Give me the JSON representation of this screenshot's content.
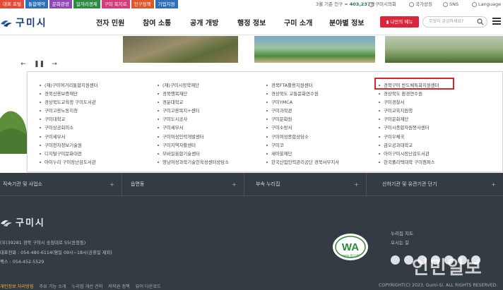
{
  "topbar": {
    "quick_links": [
      {
        "label": "대표 포털",
        "color": "#e44c3a"
      },
      {
        "label": "통합예약",
        "color": "#2f6fb9"
      },
      {
        "label": "문화관광",
        "color": "#8f4ab7"
      },
      {
        "label": "일자리경제",
        "color": "#2d8b43"
      },
      {
        "label": "구미 복지로",
        "color": "#d83b7c"
      },
      {
        "label": "인구정책",
        "color": "#e0572a"
      },
      {
        "label": "기업지원",
        "color": "#2f6fb9"
      }
    ],
    "population_prefix": "3월 기준 인구 ≈",
    "population_value": "403,237",
    "population_unit": "명",
    "council": "구미시의회",
    "sitemap": "국가상징",
    "sns": "SNS",
    "language": "Language"
  },
  "header": {
    "logo_text": "구미시",
    "nav": [
      "전자 민원",
      "참여 소통",
      "공개 개방",
      "행정 정보",
      "구미 소개",
      "분야별 정보"
    ],
    "my_menu_label": "나만의 메뉴",
    "search_placeholder": "무엇이 궁금하세요?"
  },
  "slider": {
    "prev": "←",
    "pause": "❚❚",
    "next": "→"
  },
  "dropdown": {
    "columns": [
      [
        "(재)구미여거리통합지원센터",
        "경북신용보증재단",
        "경상북도교육청 구미도서관",
        "구미고용노동지청",
        "구미대학교",
        "구미상공회의소",
        "구미세무서",
        "구미전자정보기술원",
        "디지털구미문화대전",
        "아이누리 구미장난감도서관"
      ],
      [
        "(재)구미시장학재단",
        "경북행복재단",
        "경운대학교",
        "구미고용복지+센터",
        "구미도시공사",
        "구미세무서",
        "구미여성인력개발센터",
        "구미지역자활센터",
        "모바일융합기술센터",
        "영남여성과학기술인육성센터상담소"
      ],
      [
        "경북FTA활용지원센터",
        "경상북도 교통문화연수원",
        "구미YMCA",
        "구미과학관",
        "구미문화원",
        "구미소방서",
        "구미여성종합상담소",
        "구미코",
        "새마을재단",
        "한국산업인력관리공단 경북서부지사"
      ],
      [
        "경북구미 반도체특화지원센터",
        "경상북도 환경연수원",
        "구미경찰서",
        "구미교육지원청",
        "구미문화재단",
        "구미시종합자원봉사센터",
        "구미우체국",
        "금오공과대학교",
        "아이구미시장난감도서관",
        "한국폴리텍대학 구미캠퍼스"
      ]
    ]
  },
  "footer": {
    "selects": [
      "직속기관 및 사업소",
      "읍면동",
      "부속 누리집",
      "산하기관 및 유관기관 단기"
    ],
    "logo_text": "구미시",
    "address_lines": [
      "(우)39281 경북 구미시 송정대로 55(송정동)",
      "대표전화 : 054-480-6114(평일 09시~18시(공휴일 제외)",
      "팩스 : 054-452-5529"
    ],
    "wa_label": "WA",
    "wa_sub": "WEB 접근성",
    "right_links": [
      "누리집 지도",
      "오시는 길"
    ],
    "watermark": "인민일보",
    "bottom_links": [
      "개인정보 처리방침",
      "주요 기능 소개",
      "누리집 개선 건의",
      "저작권 정책",
      "뷰어 다운로드"
    ],
    "copyright": "COPYRIGHT(C) 2023. Gumi-Si. ALL RIGHTS RESERVED."
  }
}
